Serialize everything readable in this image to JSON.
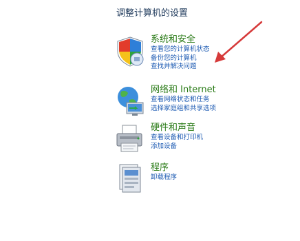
{
  "page": {
    "title": "调整计算机的设置"
  },
  "categories": [
    {
      "title": "系统和安全",
      "links": [
        "查看您的计算机状态",
        "备份您的计算机",
        "查找并解决问题"
      ]
    },
    {
      "title": "网络和 Internet",
      "links": [
        "查看网络状态和任务",
        "选择家庭组和共享选项"
      ]
    },
    {
      "title": "硬件和声音",
      "links": [
        "查看设备和打印机",
        "添加设备"
      ]
    },
    {
      "title": "程序",
      "links": [
        "卸载程序"
      ]
    }
  ],
  "colors": {
    "title": "#1e395b",
    "category": "#2a7b17",
    "link": "#1e5bb3",
    "arrow": "#d63a3a"
  },
  "icons": [
    "shield-icon",
    "network-globe-icon",
    "printer-icon",
    "programs-icon"
  ]
}
